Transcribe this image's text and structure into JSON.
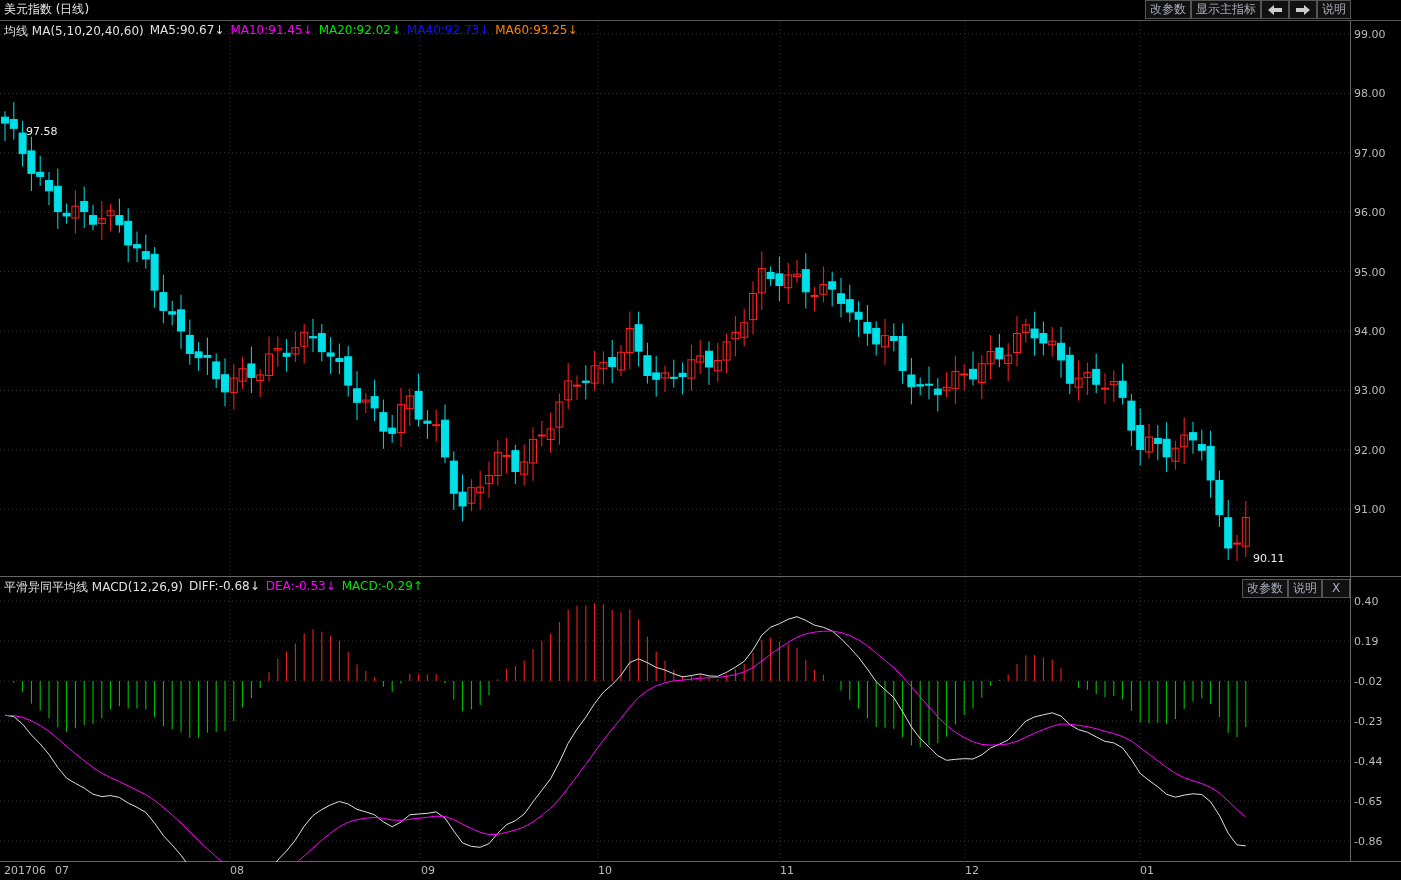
{
  "title": "美元指数 (日线)",
  "toolbar": [
    {
      "kind": "text",
      "label": "改参数"
    },
    {
      "kind": "text",
      "label": "显示主指标"
    },
    {
      "kind": "arrow-left"
    },
    {
      "kind": "arrow-right"
    },
    {
      "kind": "text",
      "label": "说明"
    }
  ],
  "main_legend": [
    {
      "text": "均线 MA(5,10,20,40,60)",
      "color": "#e0e0e0"
    },
    {
      "text": "MA5:90.67↓",
      "color": "#e0e0e0"
    },
    {
      "text": "MA10:91.45↓",
      "color": "#ff00ff"
    },
    {
      "text": "MA20:92.02↓",
      "color": "#00e600"
    },
    {
      "text": "MA40:92.73↓",
      "color": "#1010ff"
    },
    {
      "text": "MA60:93.25↓",
      "color": "#ff8000"
    }
  ],
  "price_axis": [
    "99.00",
    "98.00",
    "97.00",
    "96.00",
    "95.00",
    "94.00",
    "93.00",
    "92.00",
    "91.00"
  ],
  "high_label": "97.58",
  "low_label": "90.11",
  "macd_legend": [
    {
      "text": "平滑异同平均线 MACD(12,26,9)",
      "color": "#e0e0e0"
    },
    {
      "text": "DIFF:-0.68↓",
      "color": "#e0e0e0"
    },
    {
      "text": "DEA:-0.53↓",
      "color": "#ff00ff"
    },
    {
      "text": "MACD:-0.29↑",
      "color": "#00e600"
    }
  ],
  "macd_buttons": [
    "改参数",
    "说明",
    "X"
  ],
  "macd_axis": [
    "0.40",
    "0.19",
    "-0.02",
    "-0.23",
    "-0.44",
    "-0.65",
    "-0.86"
  ],
  "dates": [
    "201706",
    "07",
    "08",
    "09",
    "10",
    "11",
    "12",
    "01"
  ]
}
